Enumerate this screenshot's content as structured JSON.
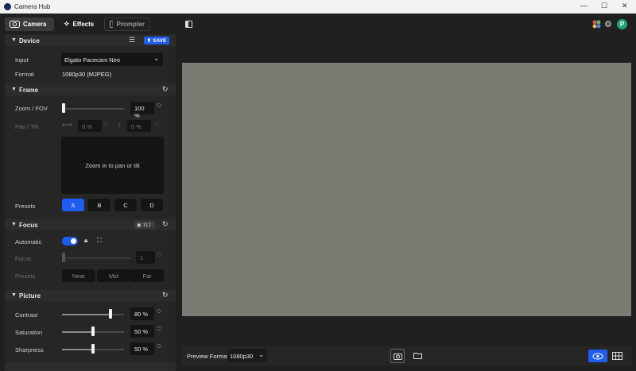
{
  "window": {
    "title": "Camera Hub",
    "minimize": "—",
    "maximize": "☐",
    "close": "✕"
  },
  "tabs": [
    {
      "label": "Camera",
      "icon": "camera-icon"
    },
    {
      "label": "Effects",
      "icon": "magic-wand-icon"
    },
    {
      "label": "Prompter",
      "icon": "prompter-icon"
    }
  ],
  "header_icons": [
    "sidebar-toggle-icon",
    "apps-icon",
    "gear-icon",
    "profile-avatar"
  ],
  "profile_initial": "P",
  "colors": {
    "accent": "#1f5df0",
    "avatar": "#1fa27a",
    "panel": "#262626",
    "preview": "#7b7b73"
  },
  "device": {
    "heading": "Device",
    "save_label": "SAVE",
    "input_label": "Input",
    "input_value": "Elgato Facecam Neo",
    "format_label": "Format",
    "format_value": "1080p30 (MJPEG)"
  },
  "frame": {
    "heading": "Frame",
    "zoom_label": "Zoom / FOV",
    "zoom_value": "100 %",
    "zoom_level": 0.0,
    "pan_tilt_label": "Pan / Tilt",
    "pan_value": "0 %",
    "tilt_value": "0 %",
    "pan_area_text": "Zoom in to pan or tilt",
    "presets_label": "Presets",
    "presets": [
      "A",
      "B",
      "C",
      "D"
    ]
  },
  "focus": {
    "heading": "Focus",
    "badge": "112",
    "automatic_label": "Automatic",
    "automatic_on": true,
    "focus_label": "Focus",
    "focus_value": "1",
    "presets_label": "Presets",
    "presets": [
      "Near",
      "Mid",
      "Far"
    ]
  },
  "picture": {
    "heading": "Picture",
    "contrast_label": "Contrast",
    "contrast_value": "80 %",
    "contrast_level": 0.8,
    "saturation_label": "Saturation",
    "saturation_value": "50 %",
    "saturation_level": 0.5,
    "sharpness_label": "Sharpness",
    "sharpness_value": "50 %",
    "sharpness_level": 0.5
  },
  "bottom": {
    "preview_format_label": "Preview Format",
    "preview_format_value": "1080p30"
  }
}
